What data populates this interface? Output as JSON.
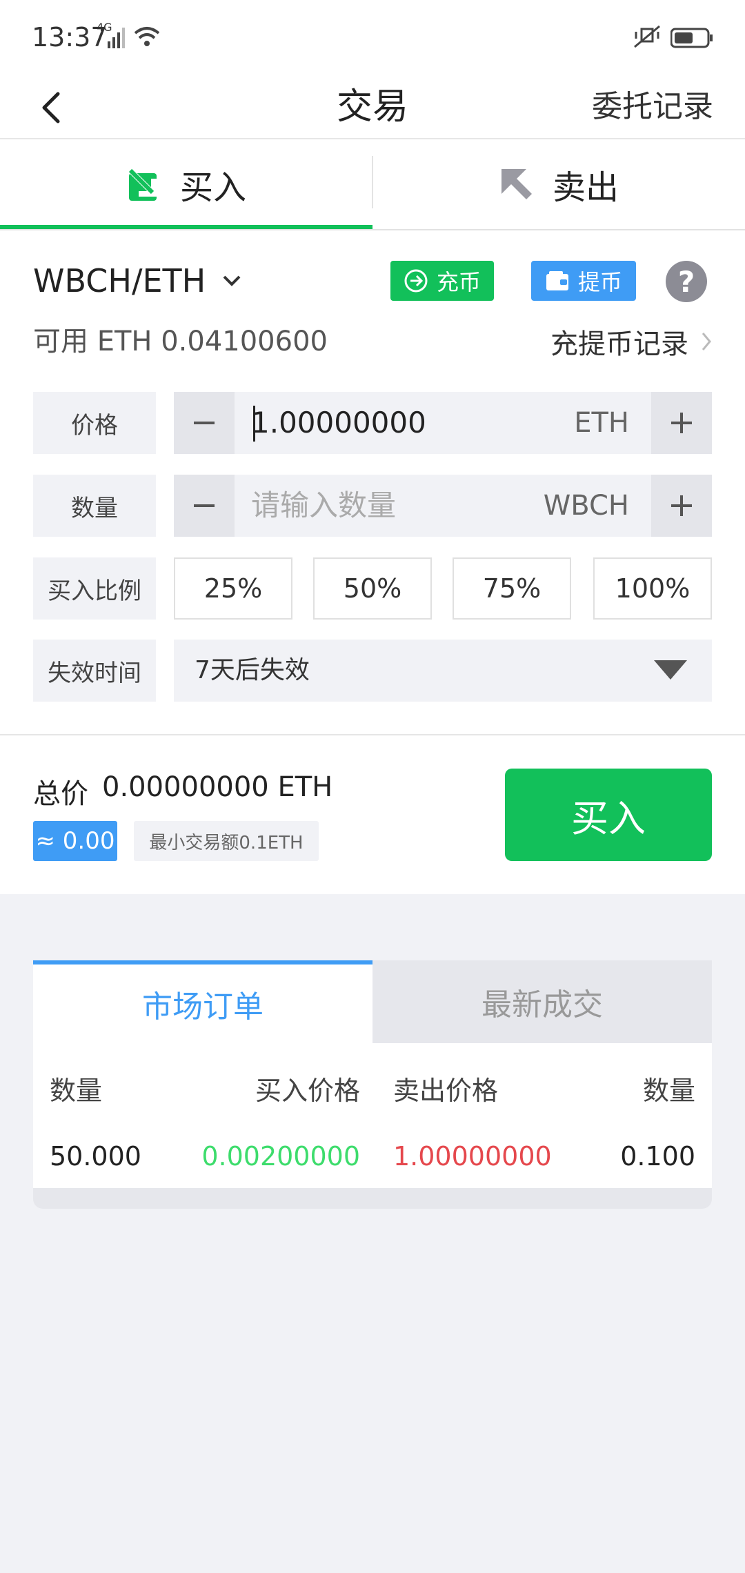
{
  "status": {
    "time": "13:37",
    "network": "4G"
  },
  "nav": {
    "title": "交易",
    "right_link": "委托记录"
  },
  "tabs": {
    "buy": "买入",
    "sell": "卖出"
  },
  "pair": {
    "name": "WBCH/ETH",
    "deposit": "充币",
    "withdraw": "提币",
    "help": "?"
  },
  "available": "可用 ETH 0.04100600",
  "records_link": "充提币记录",
  "form": {
    "price_label": "价格",
    "price_value": "1.00000000",
    "price_unit": "ETH",
    "qty_label": "数量",
    "qty_placeholder": "请输入数量",
    "qty_unit": "WBCH",
    "ratio_label": "买入比例",
    "ratios": [
      "25%",
      "50%",
      "75%",
      "100%"
    ],
    "expiry_label": "失效时间",
    "expiry_value": "7天后失效"
  },
  "summary": {
    "total_label": "总价",
    "total_value": "0.00000000 ETH",
    "approx": "≈ 0.00",
    "min_trade": "最小交易额0.1ETH",
    "buy_button": "买入"
  },
  "orderbook": {
    "tab_market": "市场订单",
    "tab_latest": "最新成交",
    "headers": [
      "数量",
      "买入价格",
      "卖出价格",
      "数量"
    ],
    "rows": [
      [
        "50.000",
        "0.00200000",
        "1.00000000",
        "0.100"
      ]
    ]
  },
  "colors": {
    "accent_green": "#12c05a",
    "accent_blue": "#3f9cf5",
    "bid": "#3ddc6c",
    "ask": "#e5484d"
  }
}
